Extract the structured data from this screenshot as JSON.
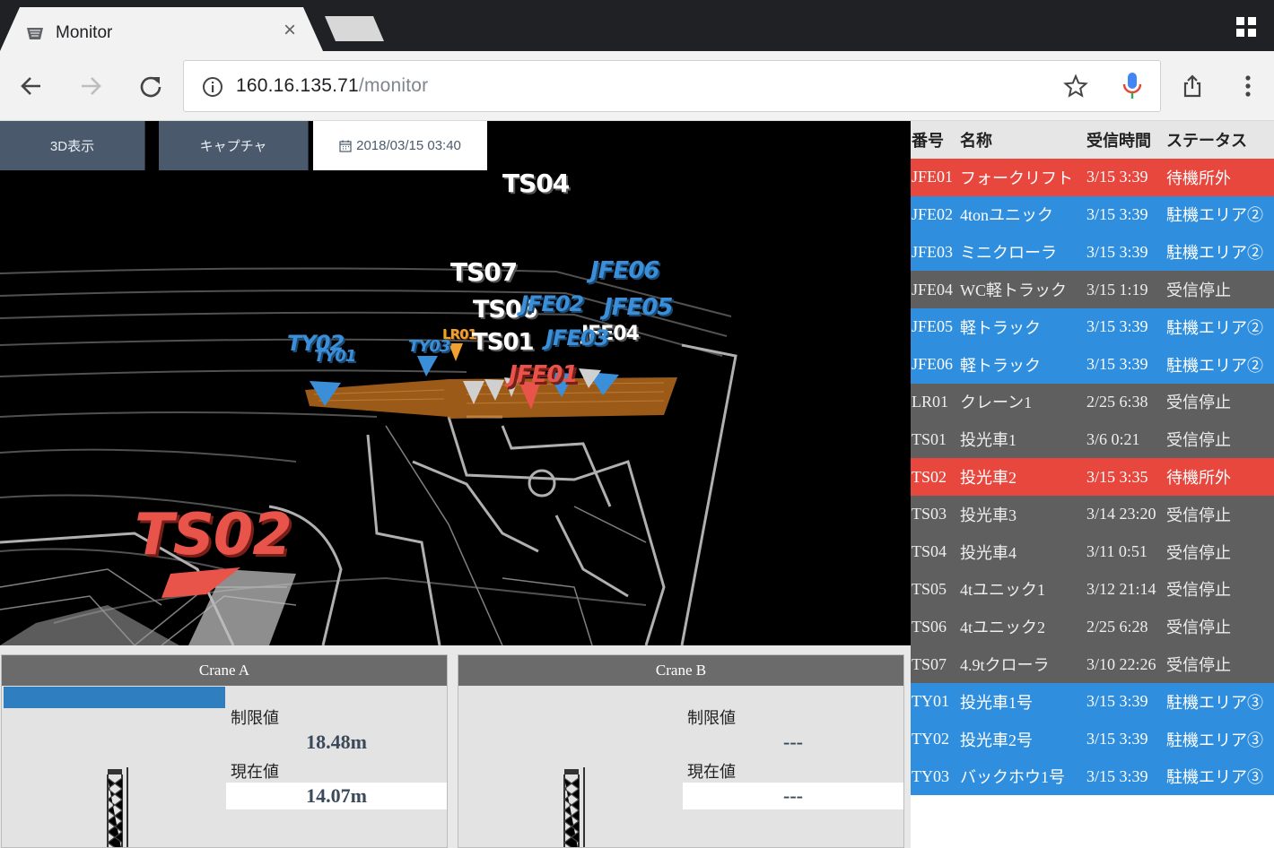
{
  "browser": {
    "tab_title": "Monitor",
    "tab_close": "×",
    "url_host": "160.16.135.71",
    "url_path": "/monitor"
  },
  "controls": {
    "view_3d_label": "3D表示",
    "capture_label": "キャプチャ",
    "datetime": "2018/03/15 03:40"
  },
  "markers": [
    {
      "label": "TS04",
      "color": "white"
    },
    {
      "label": "TS07",
      "color": "white"
    },
    {
      "label": "JFE06",
      "color": "blue"
    },
    {
      "label": "TS06",
      "color": "white"
    },
    {
      "label": "JFE02",
      "color": "blue"
    },
    {
      "label": "JFE05",
      "color": "blue"
    },
    {
      "label": "TY02",
      "color": "blue"
    },
    {
      "label": "TY01",
      "color": "blue"
    },
    {
      "label": "TY03",
      "color": "blue"
    },
    {
      "label": "LR01",
      "color": "orange"
    },
    {
      "label": "TS01",
      "color": "white"
    },
    {
      "label": "JFE03",
      "color": "blue"
    },
    {
      "label": "JFE04",
      "color": "white"
    },
    {
      "label": "JFE01",
      "color": "red"
    },
    {
      "label": "TS02",
      "color": "red"
    }
  ],
  "cranes": [
    {
      "title": "Crane A",
      "limit_label": "制限値",
      "limit_value": "18.48m",
      "current_label": "現在値",
      "current_value": "14.07m"
    },
    {
      "title": "Crane B",
      "limit_label": "制限値",
      "limit_value": "---",
      "current_label": "現在値",
      "current_value": "---"
    }
  ],
  "table": {
    "headers": [
      "番号",
      "名称",
      "受信時間",
      "ステータス"
    ],
    "status_colors": {
      "red": "#e8473e",
      "blue": "#2f8fde",
      "gray": "#5f5f5f"
    },
    "rows": [
      {
        "id": "JFE01",
        "name": "フォークリフト",
        "time": "3/15 3:39",
        "status": "待機所外",
        "color": "red"
      },
      {
        "id": "JFE02",
        "name": "4tonユニック",
        "time": "3/15 3:39",
        "status": "駐機エリア②",
        "color": "blue"
      },
      {
        "id": "JFE03",
        "name": "ミニクローラ",
        "time": "3/15 3:39",
        "status": "駐機エリア②",
        "color": "blue"
      },
      {
        "id": "JFE04",
        "name": "WC軽トラック",
        "time": "3/15 1:19",
        "status": "受信停止",
        "color": "gray"
      },
      {
        "id": "JFE05",
        "name": "軽トラック",
        "time": "3/15 3:39",
        "status": "駐機エリア②",
        "color": "blue"
      },
      {
        "id": "JFE06",
        "name": "軽トラック",
        "time": "3/15 3:39",
        "status": "駐機エリア②",
        "color": "blue"
      },
      {
        "id": "LR01",
        "name": "クレーン1",
        "time": "2/25 6:38",
        "status": "受信停止",
        "color": "gray"
      },
      {
        "id": "TS01",
        "name": "投光車1",
        "time": "3/6 0:21",
        "status": "受信停止",
        "color": "gray"
      },
      {
        "id": "TS02",
        "name": "投光車2",
        "time": "3/15 3:35",
        "status": "待機所外",
        "color": "red"
      },
      {
        "id": "TS03",
        "name": "投光車3",
        "time": "3/14 23:20",
        "status": "受信停止",
        "color": "gray"
      },
      {
        "id": "TS04",
        "name": "投光車4",
        "time": "3/11 0:51",
        "status": "受信停止",
        "color": "gray"
      },
      {
        "id": "TS05",
        "name": "4tユニック1",
        "time": "3/12 21:14",
        "status": "受信停止",
        "color": "gray"
      },
      {
        "id": "TS06",
        "name": "4tユニック2",
        "time": "2/25 6:28",
        "status": "受信停止",
        "color": "gray"
      },
      {
        "id": "TS07",
        "name": "4.9tクローラ",
        "time": "3/10 22:26",
        "status": "受信停止",
        "color": "gray"
      },
      {
        "id": "TY01",
        "name": "投光車1号",
        "time": "3/15 3:39",
        "status": "駐機エリア③",
        "color": "blue"
      },
      {
        "id": "TY02",
        "name": "投光車2号",
        "time": "3/15 3:39",
        "status": "駐機エリア③",
        "color": "blue"
      },
      {
        "id": "TY03",
        "name": "バックホウ1号",
        "time": "3/15 3:39",
        "status": "駐機エリア③",
        "color": "blue"
      }
    ]
  }
}
